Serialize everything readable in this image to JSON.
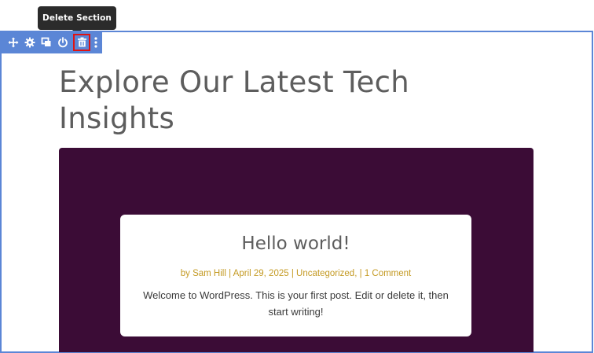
{
  "tooltip": {
    "text": "Delete Section"
  },
  "toolbar": {
    "buttons": [
      {
        "name": "move-icon",
        "label": "Move"
      },
      {
        "name": "settings-icon",
        "label": "Settings"
      },
      {
        "name": "duplicate-icon",
        "label": "Duplicate"
      },
      {
        "name": "power-icon",
        "label": "Disable"
      },
      {
        "name": "trash-icon",
        "label": "Delete Section"
      },
      {
        "name": "more-options-icon",
        "label": "More"
      }
    ],
    "accent_color": "#5b86d6",
    "highlight_color": "#e01313"
  },
  "section": {
    "title": "Explore Our Latest Tech Insights"
  },
  "post": {
    "title": "Hello world!",
    "meta": {
      "by": "by",
      "author": "Sam Hill",
      "sep1": "|",
      "date": "April 29, 2025",
      "sep2": "|",
      "category": "Uncategorized,",
      "sep3": "|",
      "comments": "1 Comment"
    },
    "excerpt": "Welcome to WordPress. This is your first post. Edit or delete it, then start writing!",
    "block_color": "#3b0c36",
    "meta_color": "#c49a23"
  }
}
